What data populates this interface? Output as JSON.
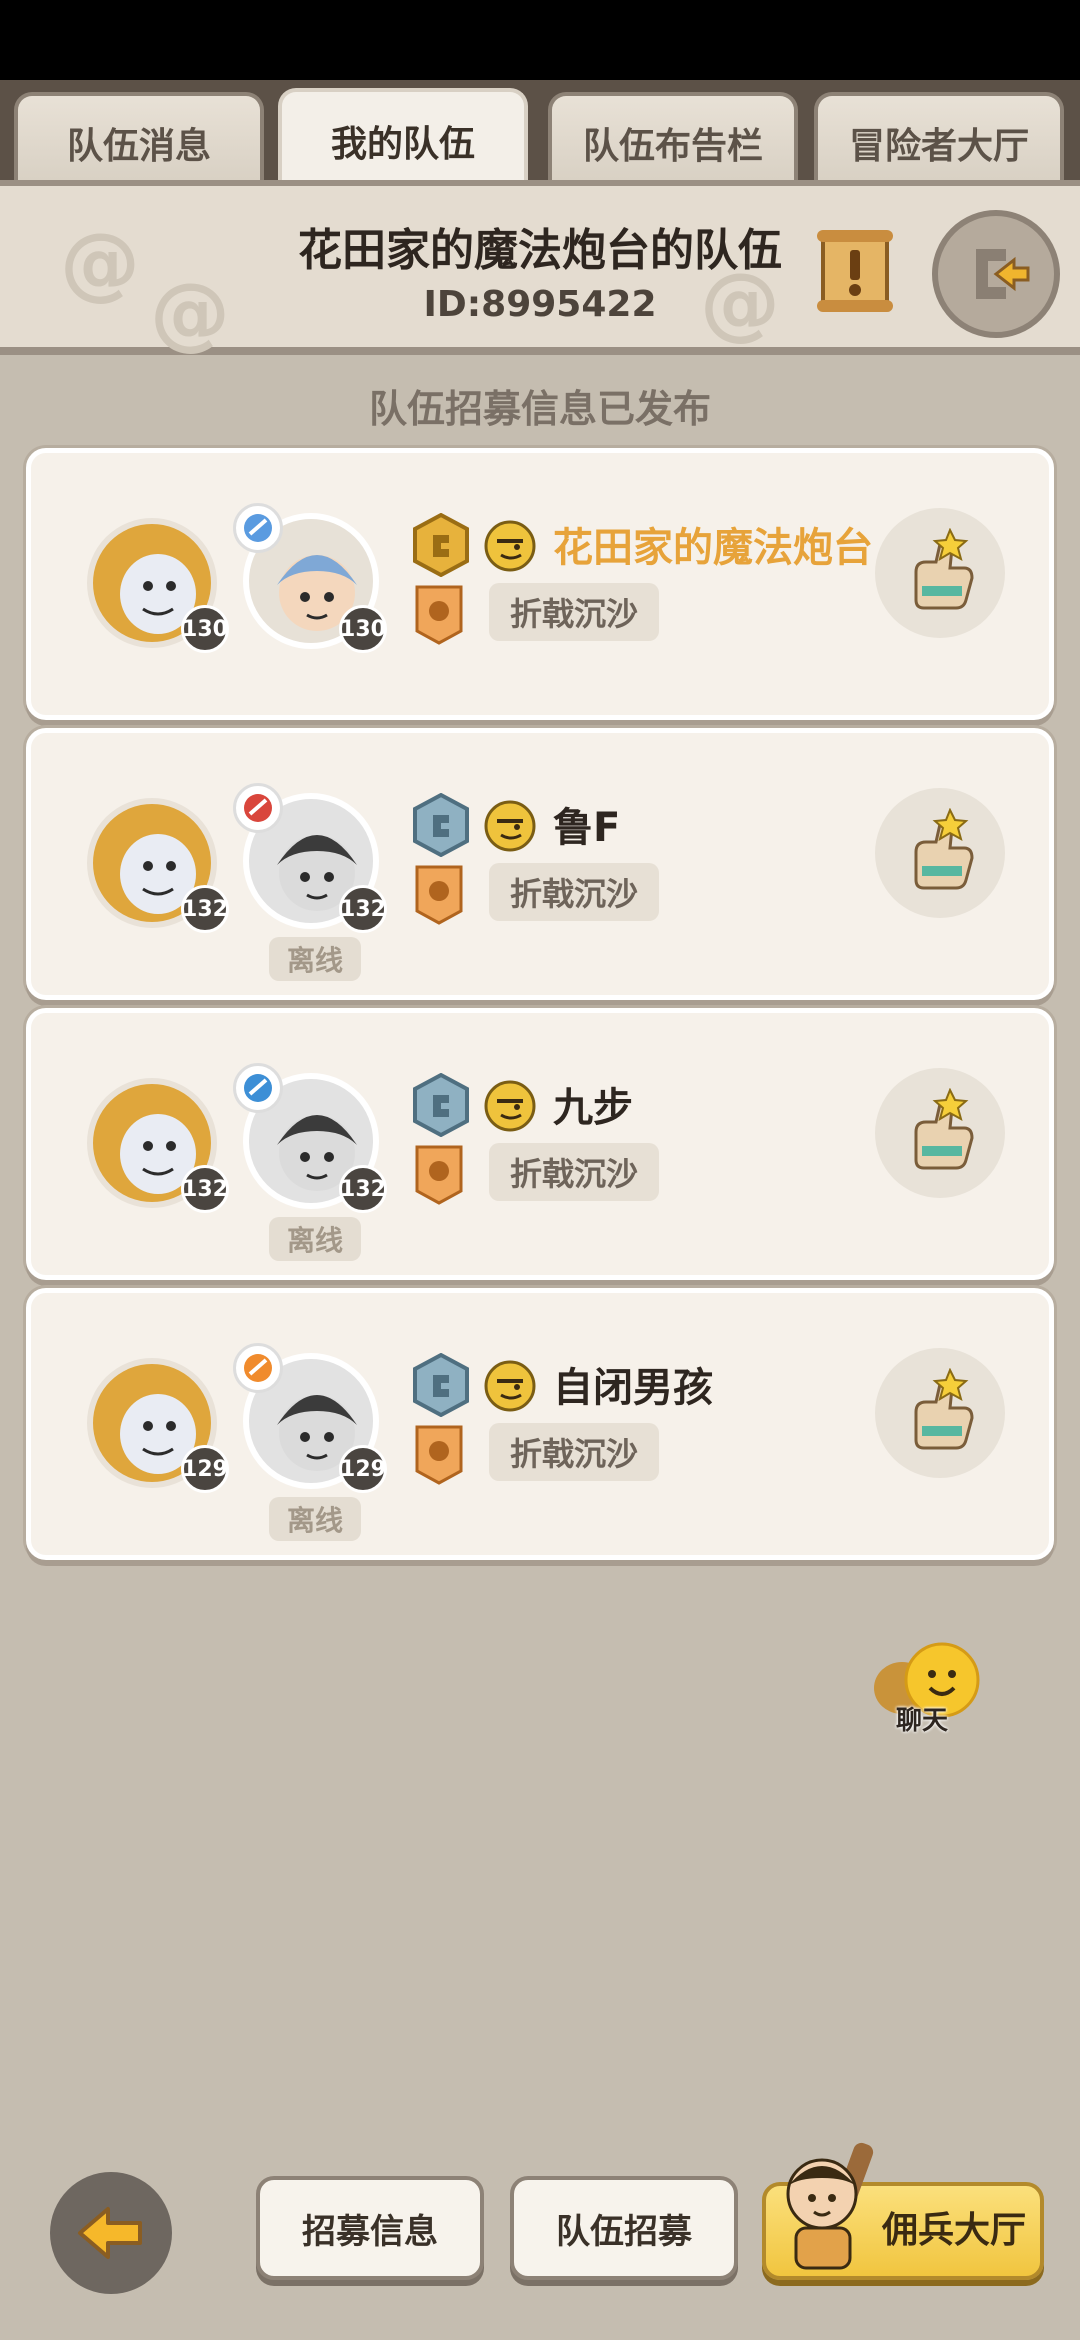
{
  "tabs": [
    {
      "label": "队伍消息",
      "active": false
    },
    {
      "label": "我的队伍",
      "active": true
    },
    {
      "label": "队伍布告栏",
      "active": false
    },
    {
      "label": "冒险者大厅",
      "active": false
    }
  ],
  "team": {
    "name": "花田家的魔法炮台的队伍",
    "id": "ID:8995422"
  },
  "recruit_status": "队伍招募信息已发布",
  "members": [
    {
      "name": "花田家的魔法炮台",
      "pet_level": "130",
      "hero_level": "130",
      "guild": "折戟沉沙",
      "status": "",
      "leader": true,
      "rank": "gold",
      "class_color": "#5a9be0"
    },
    {
      "name": "鲁F",
      "pet_level": "132",
      "hero_level": "132",
      "guild": "折戟沉沙",
      "status": "离线",
      "leader": false,
      "rank": "blue",
      "class_color": "#d9463c"
    },
    {
      "name": "九步",
      "pet_level": "132",
      "hero_level": "132",
      "guild": "折戟沉沙",
      "status": "离线",
      "leader": false,
      "rank": "blue",
      "class_color": "#3d8fd6"
    },
    {
      "name": "自闭男孩",
      "pet_level": "129",
      "hero_level": "129",
      "guild": "折戟沉沙",
      "status": "离线",
      "leader": false,
      "rank": "blue",
      "class_color": "#f08b2d"
    }
  ],
  "chat": {
    "label": "聊天"
  },
  "bottom": {
    "recruit_info": "招募信息",
    "team_recruit": "队伍招募",
    "mercenary_hall": "佣兵大厅"
  },
  "colors": {
    "background": "#c5bdb0",
    "leader_name": "#e7a33a",
    "gold_button": "#f1c53f"
  }
}
